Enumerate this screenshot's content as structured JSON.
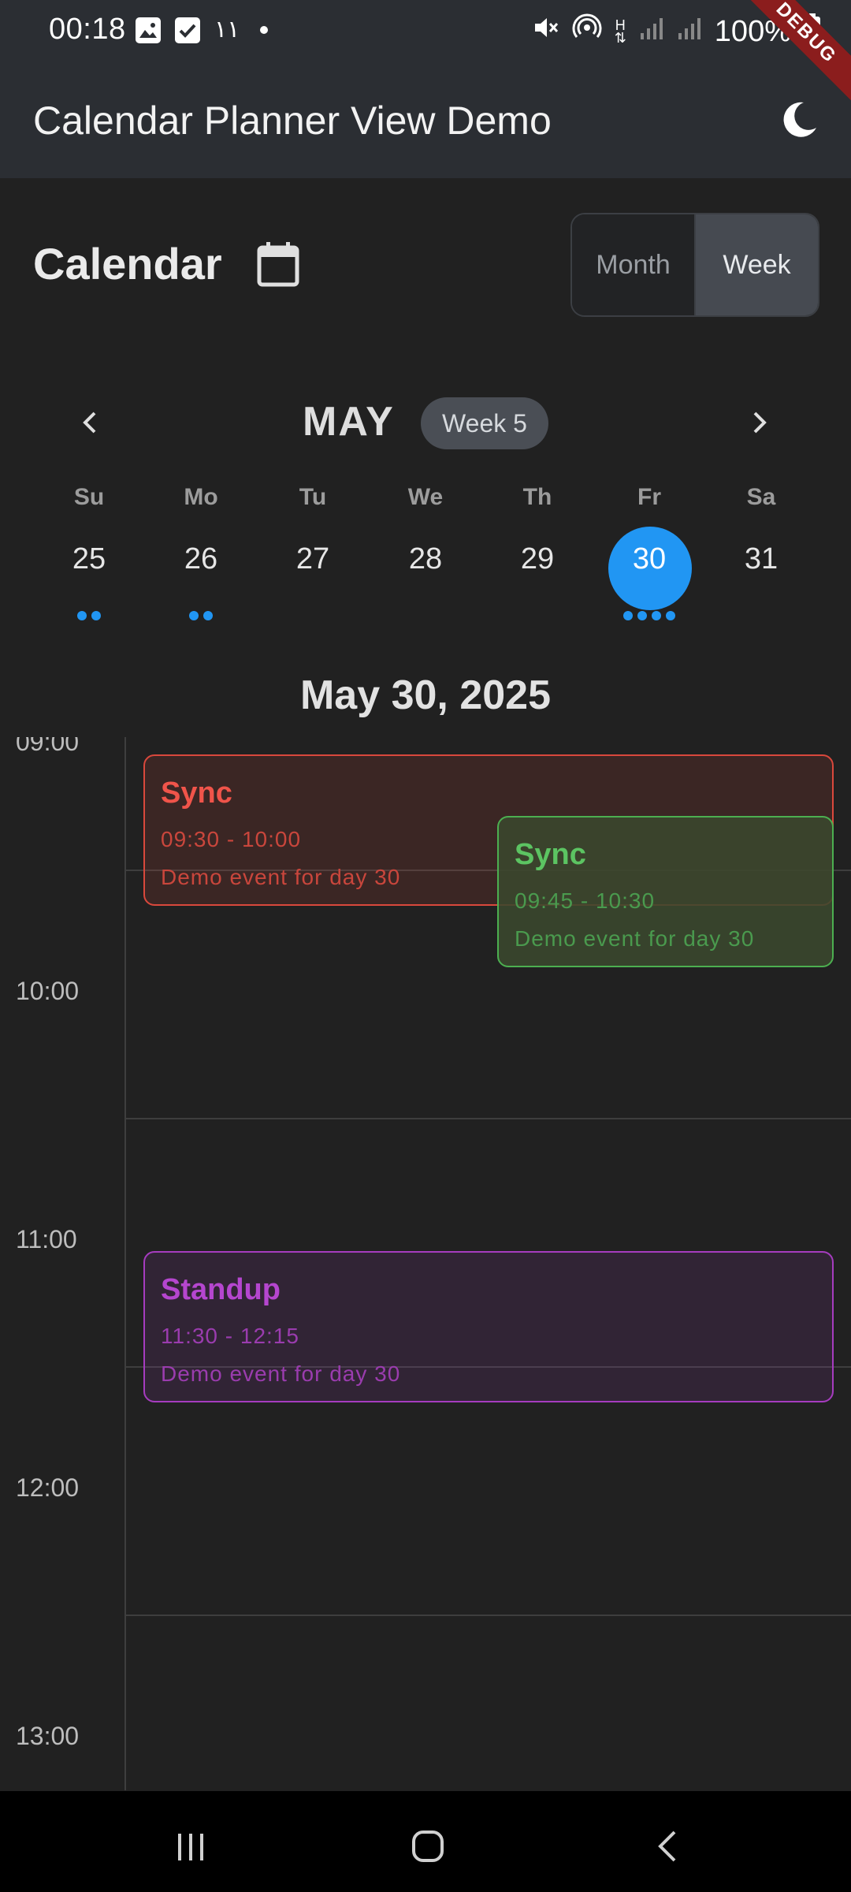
{
  "status_bar": {
    "time": "00:18",
    "arabic_digits": "١١",
    "battery": "100%",
    "h_label": "H"
  },
  "debug_banner": "DEBUG",
  "app_bar": {
    "title": "Calendar Planner View Demo",
    "theme_icon": "moon-icon"
  },
  "header": {
    "title": "Calendar",
    "calendar_icon": "calendar-icon",
    "view_toggle": {
      "month_label": "Month",
      "week_label": "Week",
      "selected": "Week"
    }
  },
  "week_nav": {
    "month": "MAY",
    "week_badge": "Week 5",
    "weekdays": [
      "Su",
      "Mo",
      "Tu",
      "We",
      "Th",
      "Fr",
      "Sa"
    ],
    "days": [
      {
        "num": "25",
        "dots": 2
      },
      {
        "num": "26",
        "dots": 2
      },
      {
        "num": "27",
        "dots": 0
      },
      {
        "num": "28",
        "dots": 0
      },
      {
        "num": "29",
        "dots": 0
      },
      {
        "num": "30",
        "dots": 4,
        "selected": true
      },
      {
        "num": "31",
        "dots": 0
      }
    ],
    "accent_color": "#2196f3"
  },
  "day_view": {
    "date_heading": "May 30, 2025",
    "hours": [
      "09:00",
      "10:00",
      "11:00",
      "12:00",
      "13:00"
    ],
    "events": [
      {
        "title": "Sync",
        "time": "09:30 - 10:00",
        "description": "Demo event for day 30",
        "color": "#e0463a"
      },
      {
        "title": "Sync",
        "time": "09:45 - 10:30",
        "description": "Demo event for day 30",
        "color": "#4caf50"
      },
      {
        "title": "Standup",
        "time": "11:30 - 12:15",
        "description": "Demo event for day 30",
        "color": "#a63cbf"
      }
    ]
  },
  "nav_bar": {
    "recents_icon": "recents-icon",
    "home_icon": "home-icon",
    "back_icon": "back-icon"
  }
}
